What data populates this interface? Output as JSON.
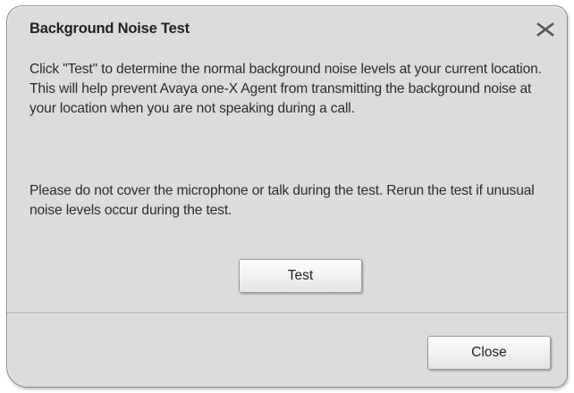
{
  "dialog": {
    "title": "Background Noise Test",
    "close_icon": "close-x-icon",
    "message_1": "Click \"Test\" to determine the normal background noise levels at your current location. This will help prevent Avaya one-X Agent from transmitting the background noise at your location when you are not speaking during a call.",
    "message_2": "Please do not cover the microphone or talk during the test. Rerun the test if unusual noise levels occur during the test.",
    "test_label": "Test",
    "close_label": "Close"
  }
}
